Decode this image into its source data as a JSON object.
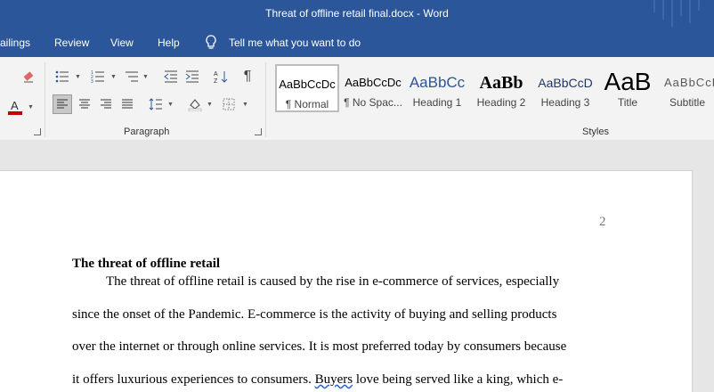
{
  "window": {
    "title": "Threat of offline retail final.docx  -  Word"
  },
  "menu": {
    "items": [
      "ailings",
      "Review",
      "View",
      "Help"
    ],
    "tell_me": "Tell me what you want to do"
  },
  "ribbon": {
    "paragraph_label": "Paragraph",
    "styles_label": "Styles",
    "styles": [
      {
        "sample": "AaBbCcDc",
        "name": "¶ Normal"
      },
      {
        "sample": "AaBbCcDc",
        "name": "¶ No Spac..."
      },
      {
        "sample": "AaBbCc",
        "name": "Heading 1"
      },
      {
        "sample": "AaBb",
        "name": "Heading 2"
      },
      {
        "sample": "AaBbCcD",
        "name": "Heading 3"
      },
      {
        "sample": "AaB",
        "name": "Title"
      },
      {
        "sample": "AaBbCcD",
        "name": "Subtitle"
      }
    ]
  },
  "document": {
    "page_number": "2",
    "heading": "The threat of offline retail",
    "lines": [
      "The threat of offline retail is caused by the rise in e-commerce of services, especially",
      "since the onset of the Pandemic. E-commerce is the activity of buying and selling products",
      "over the internet or through online services. It is most preferred today by consumers because",
      "it offers luxurious experiences to consumers. "
    ],
    "line4_word": "Buyers",
    "line4_rest": " love being served like a king, which e-"
  }
}
